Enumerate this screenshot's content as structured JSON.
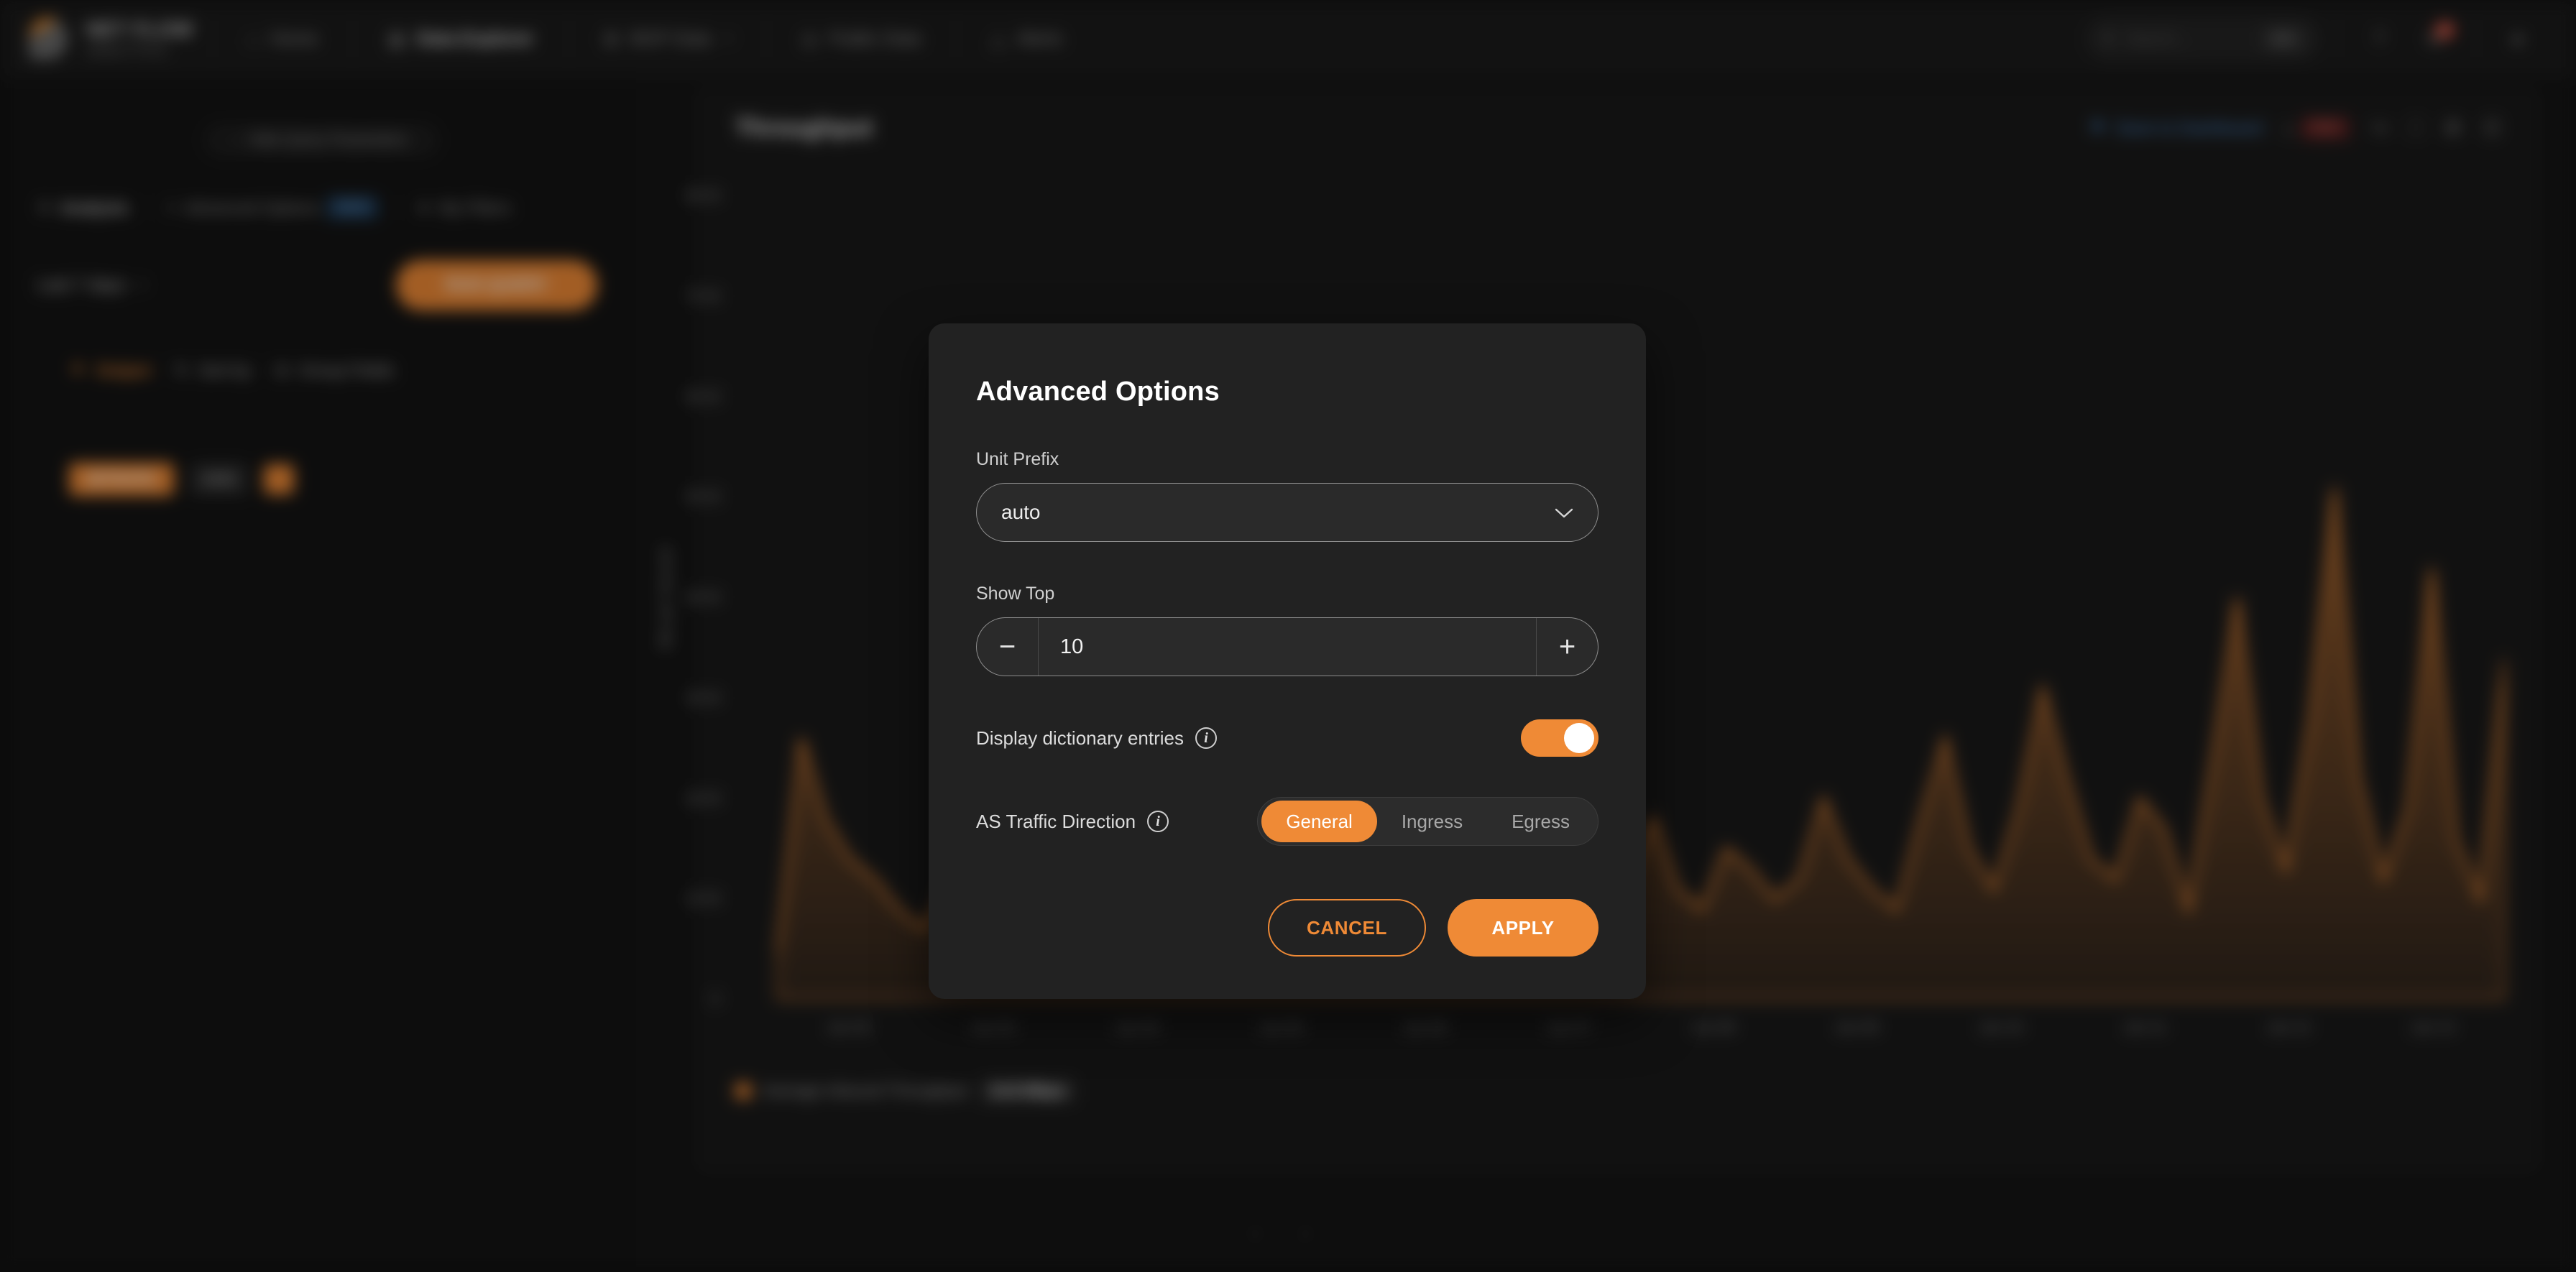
{
  "app": {
    "brand_line1": "NET FLOW",
    "brand_line2": "ANALYTICS",
    "nav": [
      {
        "icon": "home-icon",
        "glyph": "⌂",
        "label": "Home",
        "active": false
      },
      {
        "icon": "chart-icon",
        "glyph": "▦",
        "label": "Data Explorer",
        "active": true
      },
      {
        "icon": "grid-icon",
        "glyph": "⊞",
        "label": "BGP Data",
        "caret": "▾",
        "active": false
      },
      {
        "icon": "globe-icon",
        "glyph": "◎",
        "label": "Public Data",
        "active": false
      },
      {
        "icon": "bell-icon",
        "glyph": "△",
        "label": "Alerts",
        "active": false
      }
    ],
    "search": {
      "icon": "search-icon",
      "placeholder": "Search...",
      "shortcut": "⌘K"
    },
    "top_icons": [
      {
        "name": "help-icon",
        "glyph": "?"
      },
      {
        "name": "notifications-icon",
        "glyph": "✉",
        "badge": "3"
      },
      {
        "name": "account-icon",
        "glyph": "●"
      }
    ]
  },
  "sidebar": {
    "collapse": {
      "icon": "chevron-left-icon",
      "glyph": "‹",
      "label": "Hide Query Parameters"
    },
    "filters": {
      "analysis_icon": "filter-icon",
      "analysis_glyph": "⚙",
      "analysis_label": "Analysis",
      "advanced_glyph": "≡",
      "advanced_label": "Advanced Options",
      "new_tag": "NEW",
      "myfilters_glyph": "★",
      "myfilters_label": "My Filters"
    },
    "time": {
      "label": "Last 7 days",
      "caret": "▾"
    },
    "run_button": "RUN QUERY",
    "tabs": [
      {
        "name": "tab-output",
        "glyph": "▼",
        "label": "Output",
        "selected": true
      },
      {
        "name": "tab-sort-by",
        "glyph": "⇅",
        "label": "Sort by",
        "selected": false
      },
      {
        "name": "tab-group-fields",
        "glyph": "⊞",
        "label": "Group Fields",
        "selected": false
      }
    ],
    "chips": [
      {
        "name": "chip-bitrate",
        "label": "BITRATE",
        "style": "accent"
      },
      {
        "name": "chip-asn",
        "label": "ASN",
        "style": "grey"
      },
      {
        "name": "chip-add",
        "label": "",
        "style": "dot"
      }
    ]
  },
  "chart_panel": {
    "title": "Throughput",
    "save_link": {
      "icon": "bookmark-icon",
      "glyph": "⚑",
      "label": "Save to Dashboard"
    },
    "export": {
      "icon": "download-icon",
      "glyph": "⤓",
      "format": "PDF"
    },
    "tools": [
      {
        "name": "share-icon",
        "glyph": "↪"
      },
      {
        "name": "fullscreen-icon",
        "glyph": "⛶"
      },
      {
        "name": "settings-icon",
        "glyph": "⚙"
      },
      {
        "name": "table-view-icon",
        "glyph": "☷"
      }
    ],
    "footer_legend": {
      "label": "Average Inbound Throughput",
      "value": "14.8 Mbps"
    },
    "pager": [
      "‹",
      "›"
    ]
  },
  "chart_data": {
    "type": "area",
    "title": "Throughput",
    "xlabel": "",
    "ylabel": "Bits per Second",
    "ylim": [
      0,
      80
    ],
    "yticks": [
      "80 M",
      "70 M",
      "60 M",
      "50 M",
      "40 M",
      "30 M",
      "20 M",
      "10 M",
      "0"
    ],
    "xticks": [
      "Jun 02",
      "Jun 03",
      "Jun 04",
      "Jun 05",
      "Jun 06",
      "Jun 07",
      "Jun 08",
      "Jun 09",
      "Jun 10",
      "Jun 11",
      "Jun 12",
      "Jun 13"
    ],
    "grid": true,
    "legend_position": "bottom-left",
    "series": [
      {
        "name": "Throughput",
        "color": "#ef8a36",
        "values": [
          4,
          26,
          18,
          14,
          12,
          9,
          7,
          11,
          10,
          8,
          13,
          24,
          10,
          7,
          9,
          12,
          20,
          9,
          11,
          8,
          10,
          14,
          19,
          11,
          8,
          12,
          17,
          10,
          9,
          13,
          11,
          16,
          10,
          9,
          14,
          12,
          18,
          11,
          9,
          15,
          13,
          10,
          12,
          20,
          14,
          11,
          9,
          18,
          26,
          15,
          11,
          19,
          31,
          22,
          14,
          12,
          20,
          17,
          9,
          24,
          40,
          20,
          13,
          28,
          51,
          22,
          12,
          19,
          43,
          16,
          10,
          34
        ]
      }
    ]
  },
  "modal": {
    "title": "Advanced Options",
    "unit_prefix": {
      "label": "Unit Prefix",
      "value": "auto",
      "caret_icon": "chevron-down-icon",
      "caret": "⌄"
    },
    "show_top": {
      "label": "Show Top",
      "value": "10",
      "minus": "−",
      "plus": "+"
    },
    "dictionary": {
      "label": "Display dictionary entries",
      "info": "i",
      "enabled": true
    },
    "as_traffic_direction": {
      "label": "AS Traffic Direction",
      "info": "i",
      "options": [
        "General",
        "Ingress",
        "Egress"
      ],
      "selected": "General"
    },
    "cancel_label": "CANCEL",
    "apply_label": "APPLY"
  },
  "colors": {
    "accent": "#ef8a36",
    "modal_bg": "#222222",
    "app_bg": "#151515",
    "link_blue": "#4a90d9",
    "badge_red": "#d8432f"
  }
}
